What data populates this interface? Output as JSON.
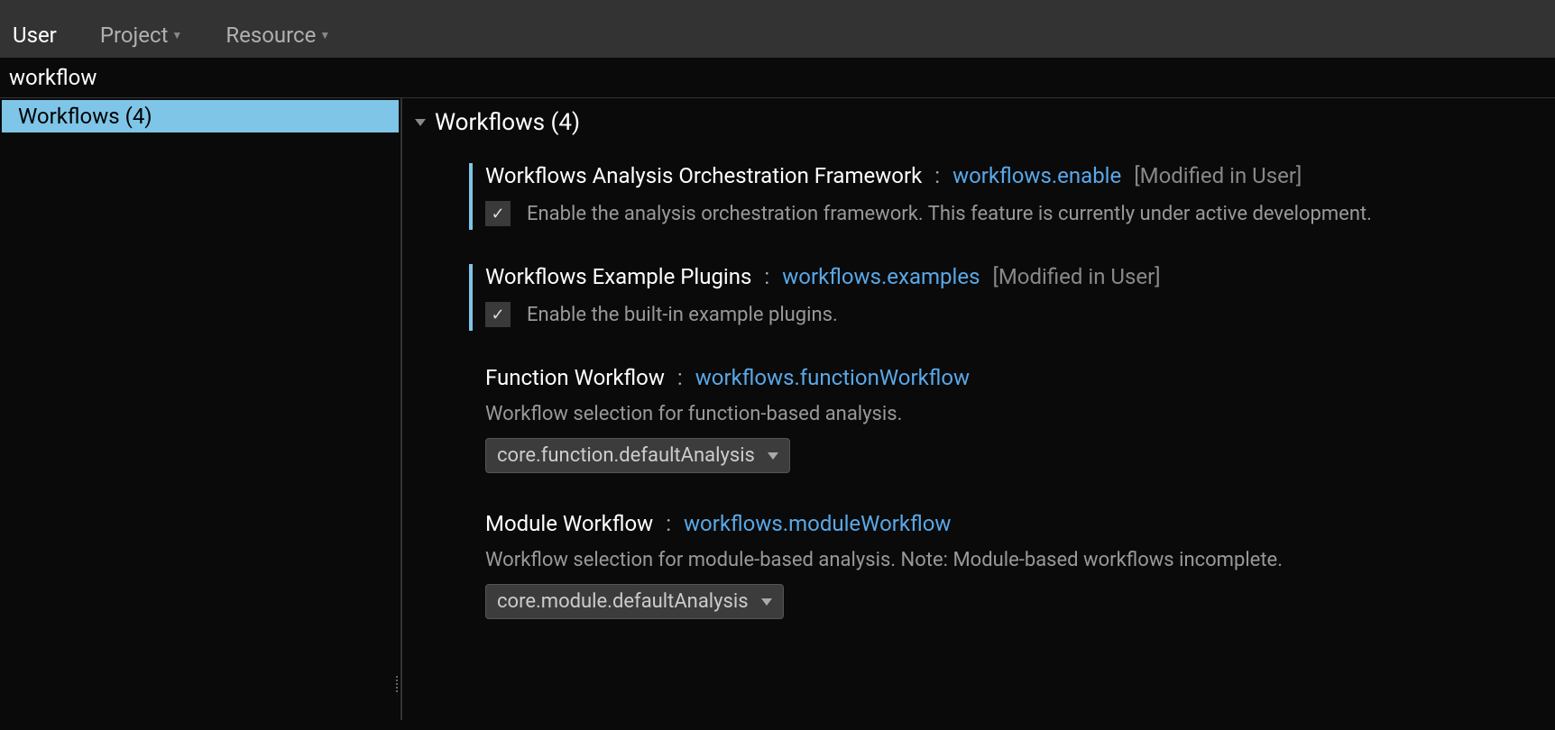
{
  "tabs": {
    "user": "User",
    "project": "Project",
    "resource": "Resource"
  },
  "search": {
    "value": "workflow"
  },
  "sidebar": {
    "items": [
      {
        "label": "Workflows (4)"
      }
    ]
  },
  "section": {
    "title": "Workflows (4)"
  },
  "settings": [
    {
      "title": "Workflows Analysis Orchestration Framework",
      "key": "workflows.enable",
      "scope": "[Modified in User]",
      "modified": true,
      "type": "checkbox",
      "checked": true,
      "description": "Enable the analysis orchestration framework. This feature is currently under active development."
    },
    {
      "title": "Workflows Example Plugins",
      "key": "workflows.examples",
      "scope": "[Modified in User]",
      "modified": true,
      "type": "checkbox",
      "checked": true,
      "description": "Enable the built-in example plugins."
    },
    {
      "title": "Function Workflow",
      "key": "workflows.functionWorkflow",
      "scope": "",
      "modified": false,
      "type": "dropdown",
      "description": "Workflow selection for function-based analysis.",
      "value": "core.function.defaultAnalysis"
    },
    {
      "title": "Module Workflow",
      "key": "workflows.moduleWorkflow",
      "scope": "",
      "modified": false,
      "type": "dropdown",
      "description": "Workflow selection for module-based analysis. Note: Module-based workflows incomplete.",
      "value": "core.module.defaultAnalysis"
    }
  ]
}
